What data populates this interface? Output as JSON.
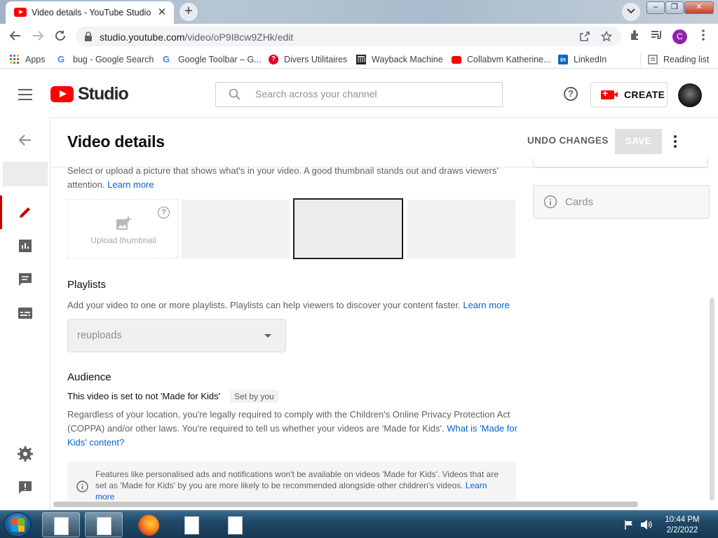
{
  "browser": {
    "tab_title": "Video details - YouTube Studio",
    "tab_close": "✕",
    "new_tab": "+",
    "url_host": "studio.youtube.com",
    "url_path": "/video/oP9I8cw9ZHk/edit",
    "profile_initial": "C",
    "window_controls": {
      "minimize": "–",
      "maximize": "❐",
      "close": "✕"
    }
  },
  "bookmarks": [
    {
      "label": "Apps",
      "icon": "apps-grid-icon"
    },
    {
      "label": "bug - Google Search",
      "icon": "google-icon"
    },
    {
      "label": "Google Toolbar – G...",
      "icon": "google-icon"
    },
    {
      "label": "Divers Utilitaires",
      "icon": "pinterest-icon"
    },
    {
      "label": "Wayback Machine",
      "icon": "wayback-icon"
    },
    {
      "label": "Collabvm Katherine...",
      "icon": "youtube-icon"
    },
    {
      "label": "LinkedIn",
      "icon": "linkedin-icon"
    }
  ],
  "reading_list": "Reading list",
  "studio": {
    "logo_text": "Studio",
    "search_placeholder": "Search across your channel",
    "help": "?",
    "create_label": "CREATE"
  },
  "page": {
    "title": "Video details",
    "undo_label": "UNDO CHANGES",
    "save_label": "SAVE"
  },
  "thumbnail": {
    "description": "Select or upload a picture that shows what's in your video. A good thumbnail stands out and draws viewers'",
    "description_line2": "attention.",
    "learn_more": "Learn more",
    "upload_label": "Upload thumbnail"
  },
  "playlists": {
    "heading": "Playlists",
    "description": "Add your video to one or more playlists. Playlists can help viewers to discover your content faster.",
    "learn_more": "Learn more",
    "selected": "reuploads"
  },
  "audience": {
    "heading": "Audience",
    "status": "This video is set to not 'Made for Kids'",
    "badge": "Set by you",
    "body_line1": "Regardless of your location, you're legally required to comply with the Children's Online Privacy Protection Act",
    "body_line2": "(COPPA) and/or other laws. You're required to tell us whether your videos are 'Made for Kids'.",
    "link_part1": "What is 'Made for",
    "link_part2": "Kids' content?",
    "notice_line1": "Features like personalised ads and notifications won't be available on videos 'Made for Kids'. Videos that are",
    "notice_line2": "set as 'Made for Kids' by you are more likely to be recommended alongside other children's videos.",
    "notice_link": "Learn",
    "notice_line3": "more"
  },
  "right_panel": {
    "cards_label": "Cards"
  },
  "taskbar": {
    "time": "10:44 PM",
    "date": "2/2/2022"
  },
  "colors": {
    "brand_red": "#ff0000",
    "link_blue": "#065fd4",
    "rail_accent": "#cc0000"
  }
}
